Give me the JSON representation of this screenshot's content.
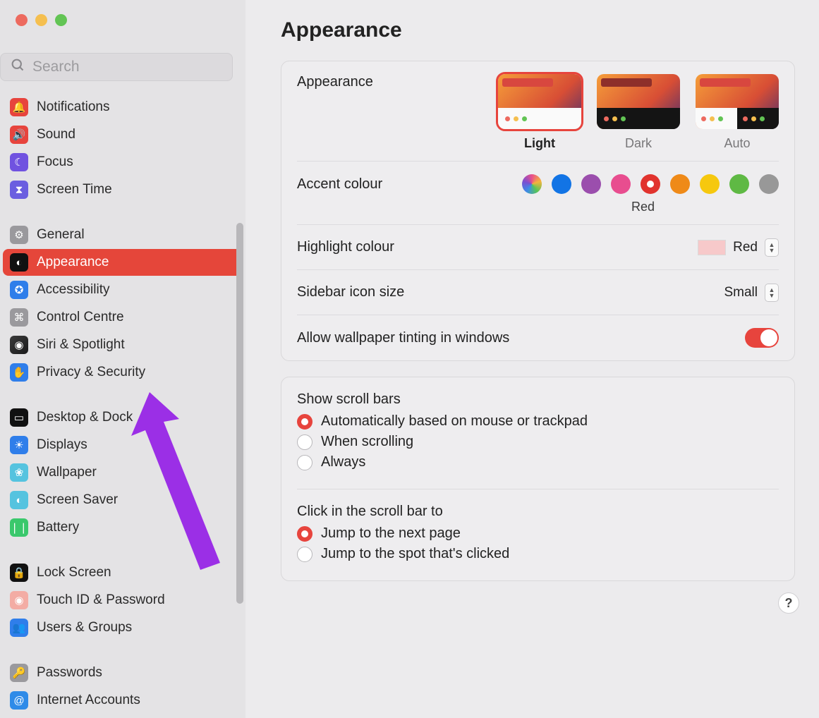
{
  "window": {
    "title": "Appearance"
  },
  "search": {
    "placeholder": "Search"
  },
  "sidebar": {
    "groups": [
      [
        {
          "label": "Notifications",
          "icon": "ic-notifications",
          "glyph": "🔔"
        },
        {
          "label": "Sound",
          "icon": "ic-sound",
          "glyph": "🔊"
        },
        {
          "label": "Focus",
          "icon": "ic-focus",
          "glyph": "☾"
        },
        {
          "label": "Screen Time",
          "icon": "ic-screentime",
          "glyph": "⧗"
        }
      ],
      [
        {
          "label": "General",
          "icon": "ic-general",
          "glyph": "⚙"
        },
        {
          "label": "Appearance",
          "icon": "ic-appearance",
          "glyph": "◐",
          "selected": true
        },
        {
          "label": "Accessibility",
          "icon": "ic-accessibility",
          "glyph": "✪"
        },
        {
          "label": "Control Centre",
          "icon": "ic-controlcentre",
          "glyph": "⌘"
        },
        {
          "label": "Siri & Spotlight",
          "icon": "ic-siri",
          "glyph": "◉"
        },
        {
          "label": "Privacy & Security",
          "icon": "ic-privacy",
          "glyph": "✋"
        }
      ],
      [
        {
          "label": "Desktop & Dock",
          "icon": "ic-desktop",
          "glyph": "▭"
        },
        {
          "label": "Displays",
          "icon": "ic-displays",
          "glyph": "☀"
        },
        {
          "label": "Wallpaper",
          "icon": "ic-wallpaper",
          "glyph": "❀"
        },
        {
          "label": "Screen Saver",
          "icon": "ic-screensaver",
          "glyph": "◐"
        },
        {
          "label": "Battery",
          "icon": "ic-battery",
          "glyph": "❘❘"
        }
      ],
      [
        {
          "label": "Lock Screen",
          "icon": "ic-lockscreen",
          "glyph": "🔒"
        },
        {
          "label": "Touch ID & Password",
          "icon": "ic-touchid",
          "glyph": "◉"
        },
        {
          "label": "Users & Groups",
          "icon": "ic-users",
          "glyph": "👥"
        }
      ],
      [
        {
          "label": "Passwords",
          "icon": "ic-passwords",
          "glyph": "🔑"
        },
        {
          "label": "Internet Accounts",
          "icon": "ic-internet",
          "glyph": "@"
        }
      ]
    ]
  },
  "appearance": {
    "section_label": "Appearance",
    "modes": [
      {
        "label": "Light",
        "selected": true
      },
      {
        "label": "Dark",
        "selected": false
      },
      {
        "label": "Auto",
        "selected": false
      }
    ],
    "accent": {
      "label": "Accent colour",
      "selected_name": "Red",
      "colours": [
        "multicolour",
        "blue",
        "purple",
        "pink",
        "red",
        "orange",
        "yellow",
        "green",
        "graphite"
      ],
      "selected": "red"
    },
    "highlight": {
      "label": "Highlight colour",
      "value": "Red",
      "swatch": "#f7c9ca"
    },
    "sidebar_size": {
      "label": "Sidebar icon size",
      "value": "Small"
    },
    "tinting": {
      "label": "Allow wallpaper tinting in windows",
      "value": true
    }
  },
  "scroll": {
    "show": {
      "label": "Show scroll bars",
      "options": [
        {
          "label": "Automatically based on mouse or trackpad",
          "selected": true
        },
        {
          "label": "When scrolling",
          "selected": false
        },
        {
          "label": "Always",
          "selected": false
        }
      ]
    },
    "click": {
      "label": "Click in the scroll bar to",
      "options": [
        {
          "label": "Jump to the next page",
          "selected": true
        },
        {
          "label": "Jump to the spot that's clicked",
          "selected": false
        }
      ]
    }
  },
  "help_glyph": "?"
}
